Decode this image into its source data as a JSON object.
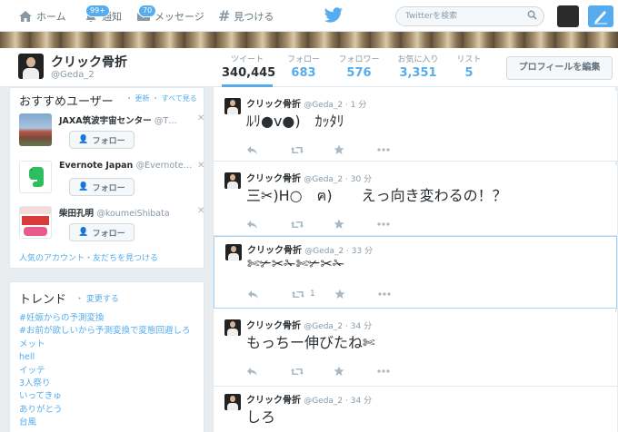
{
  "nav": {
    "home": "ホーム",
    "notifications": "通知",
    "notifications_badge": "99+",
    "messages": "メッセージ",
    "messages_badge": "70",
    "discover": "見つける",
    "search_placeholder": "Twitterを検索"
  },
  "profile": {
    "name": "クリック骨折",
    "handle": "@Geda_2",
    "stats": [
      {
        "label": "ツイート",
        "value": "340,445"
      },
      {
        "label": "フォロー",
        "value": "683"
      },
      {
        "label": "フォロワー",
        "value": "576"
      },
      {
        "label": "お気に入り",
        "value": "3,351"
      },
      {
        "label": "リスト",
        "value": "5"
      }
    ],
    "edit_button": "プロフィールを編集"
  },
  "who_to_follow": {
    "title": "おすすめユーザー",
    "links": "・ 更新 ・ すべて見る",
    "users": [
      {
        "name": "JAXA筑波宇宙センター",
        "handle": "@T…",
        "follow": "フォロー"
      },
      {
        "name": "Evernote Japan",
        "handle": "@Evernote…",
        "follow": "フォロー"
      },
      {
        "name": "柴田孔明",
        "handle": "@koumeiShibata",
        "follow": "フォロー"
      }
    ],
    "footer": "人気のアカウント・友だちを見つける"
  },
  "trends": {
    "title": "トレンド",
    "change": "・ 変更する",
    "items": [
      "#妊娠からの予測変換",
      "#お前が欲しいから予測変換で変態回避しろ",
      "メット",
      "hell",
      "イッテ",
      "3人祭り",
      "いってきゅ",
      "ありがとう",
      "台風"
    ]
  },
  "tweets": [
    {
      "name": "クリック骨折",
      "handle": "@Geda_2",
      "time": "1 分",
      "text": "ﾙﾘ●v●)　ｶｯﾀﾘ",
      "retweets": ""
    },
    {
      "name": "クリック骨折",
      "handle": "@Geda_2",
      "time": "30 分",
      "text": "三✂)H○　ฅ)　　えっ向き変わるの！？",
      "retweets": ""
    },
    {
      "name": "クリック骨折",
      "handle": "@Geda_2",
      "time": "33 分",
      "text": "✄✃✂✁✄✃✂✁",
      "retweets": "1"
    },
    {
      "name": "クリック骨折",
      "handle": "@Geda_2",
      "time": "34 分",
      "text": "もっちー伸びたね✄",
      "retweets": ""
    },
    {
      "name": "クリック骨折",
      "handle": "@Geda_2",
      "time": "34 分",
      "text": "しろ",
      "retweets": ""
    }
  ],
  "colors": {
    "accent": "#55acee",
    "text": "#292f33",
    "muted": "#8899a6"
  }
}
